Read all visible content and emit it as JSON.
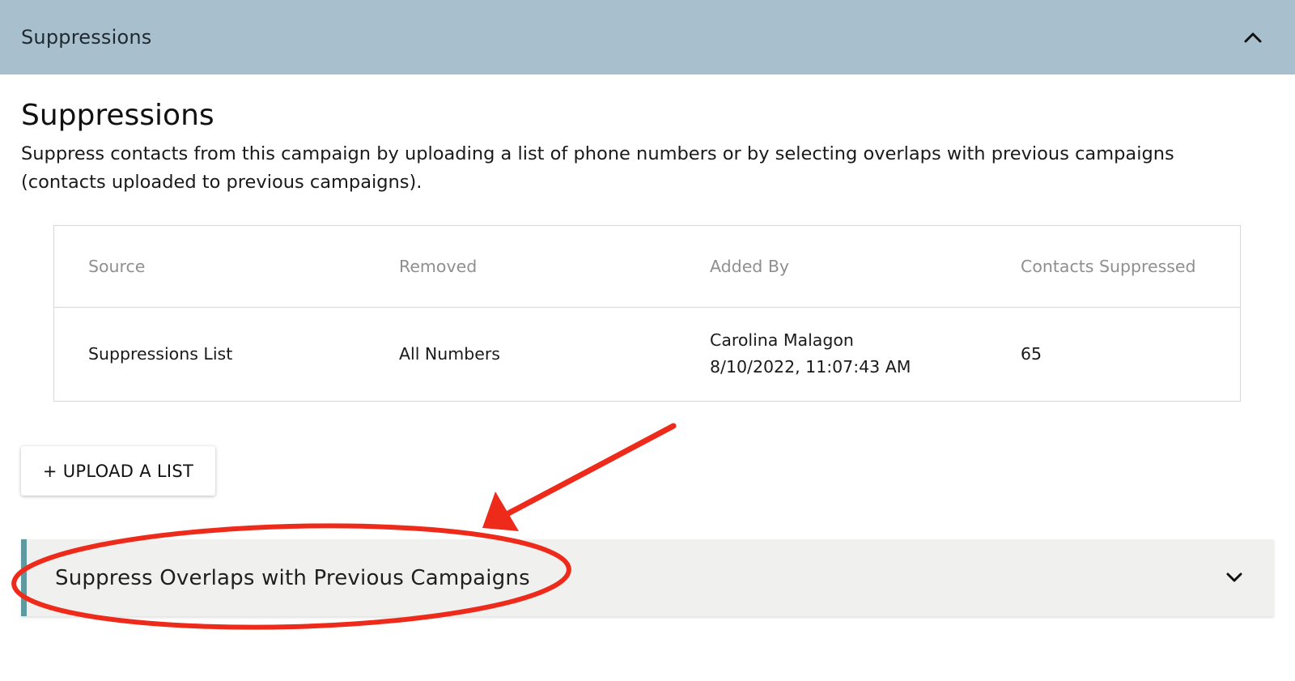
{
  "header": {
    "title": "Suppressions",
    "toggle_icon": "chevron-up-icon"
  },
  "section": {
    "title": "Suppressions",
    "description": "Suppress contacts from this campaign by uploading a list of phone numbers or by selecting overlaps with previous campaigns (contacts uploaded to previous campaigns)."
  },
  "table": {
    "columns": [
      "Source",
      "Removed",
      "Added By",
      "Contacts Suppressed"
    ],
    "rows": [
      {
        "source": "Suppressions List",
        "removed": "All Numbers",
        "added_by_name": "Carolina Malagon",
        "added_by_time": "8/10/2022, 11:07:43 AM",
        "contacts_suppressed": "65"
      }
    ]
  },
  "upload_button": {
    "label": "+ UPLOAD A LIST"
  },
  "overlaps_panel": {
    "title": "Suppress Overlaps with Previous Campaigns",
    "toggle_icon": "chevron-down-icon"
  },
  "colors": {
    "header_bg": "#a8bfcd",
    "panel_bg": "#f0f1ef",
    "panel_accent": "#5e9aa0",
    "annotation": "#ee2a1b"
  }
}
